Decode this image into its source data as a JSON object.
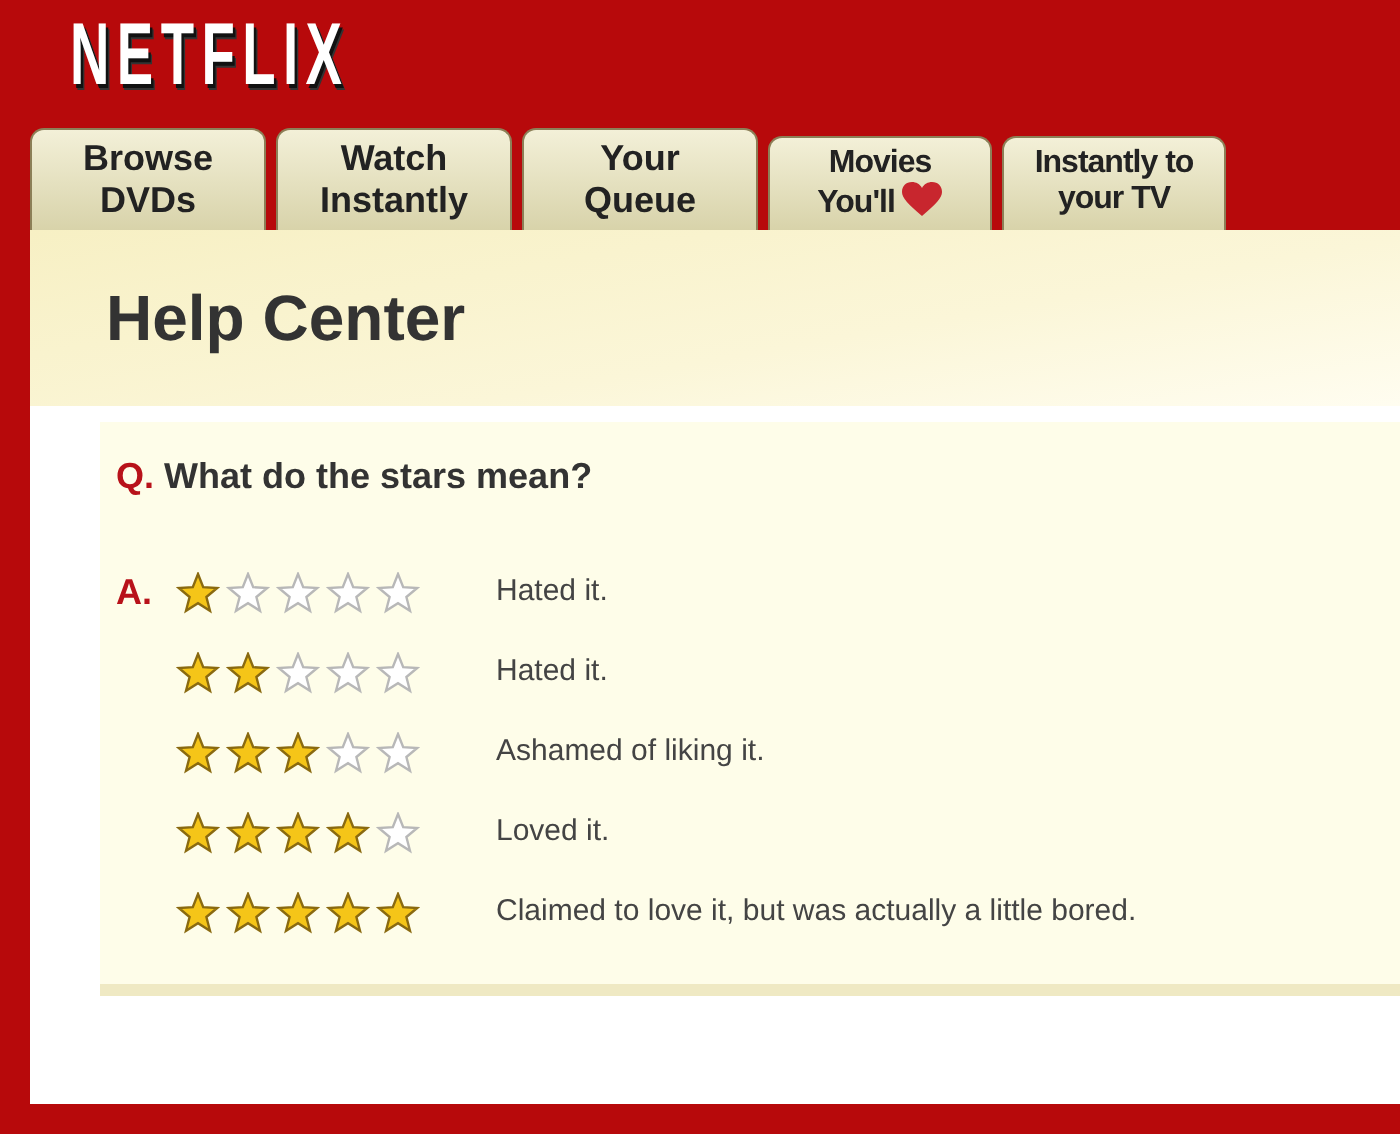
{
  "logo": "NETFLIX",
  "tabs": [
    {
      "lines": [
        "Browse",
        "DVDs"
      ]
    },
    {
      "lines": [
        "Watch",
        "Instantly"
      ]
    },
    {
      "lines": [
        "Your",
        "Queue"
      ]
    },
    {
      "lines": [
        "Movies",
        "You'll"
      ],
      "heart": true
    },
    {
      "lines": [
        "Instantly to",
        "your TV"
      ]
    }
  ],
  "page_title": "Help Center",
  "question": {
    "marker": "Q.",
    "text": "What do the stars mean?"
  },
  "answer_marker": "A.",
  "ratings": [
    {
      "stars": 1,
      "text": "Hated it."
    },
    {
      "stars": 2,
      "text": "Hated it."
    },
    {
      "stars": 3,
      "text": "Ashamed of liking it."
    },
    {
      "stars": 4,
      "text": "Loved it."
    },
    {
      "stars": 5,
      "text": "Claimed to love it, but was actually a little bored."
    }
  ]
}
